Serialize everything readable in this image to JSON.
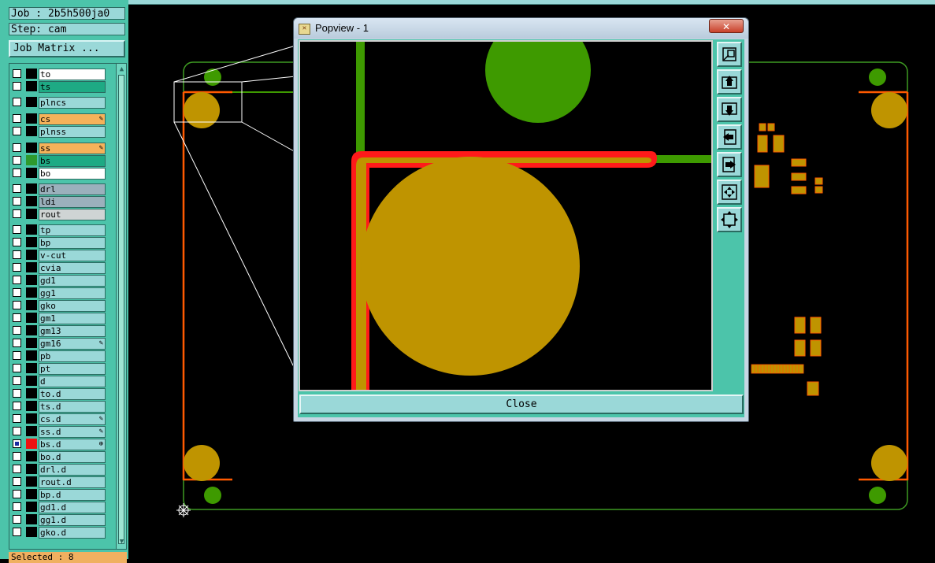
{
  "job_info": {
    "job_label": "Job : 2b5h500ja0",
    "step_label": "Step: cam"
  },
  "job_matrix_button": "Job Matrix ...",
  "layers": [
    {
      "name": "to",
      "bg": "#ffffff",
      "swatch": "#000000"
    },
    {
      "name": "ts",
      "bg": "#1eaa84",
      "swatch": "#000000"
    },
    {
      "name": "plncs",
      "bg": "#9ad8d8",
      "swatch": "#000000"
    },
    {
      "name": "cs",
      "bg": "#f5b25a",
      "swatch": "#000000",
      "mark": "✎"
    },
    {
      "name": "plnss",
      "bg": "#9ad8d8",
      "swatch": "#000000"
    },
    {
      "name": "ss",
      "bg": "#f5b25a",
      "swatch": "#000000",
      "mark": "✎"
    },
    {
      "name": "bs",
      "bg": "#1eaa84",
      "swatch": "#2e9a2e"
    },
    {
      "name": "bo",
      "bg": "#ffffff",
      "swatch": "#000000"
    },
    {
      "name": "drl",
      "bg": "#9bb0bc",
      "swatch": "#000000"
    },
    {
      "name": "ldi",
      "bg": "#9bb0bc",
      "swatch": "#000000"
    },
    {
      "name": "rout",
      "bg": "#cfd4d4",
      "swatch": "#000000"
    },
    {
      "name": "tp",
      "bg": "#9ad8d8",
      "swatch": "#000000"
    },
    {
      "name": "bp",
      "bg": "#9ad8d8",
      "swatch": "#000000"
    },
    {
      "name": "v-cut",
      "bg": "#9ad8d8",
      "swatch": "#000000"
    },
    {
      "name": "cvia",
      "bg": "#9ad8d8",
      "swatch": "#000000"
    },
    {
      "name": "gd1",
      "bg": "#9ad8d8",
      "swatch": "#000000"
    },
    {
      "name": "gg1",
      "bg": "#9ad8d8",
      "swatch": "#000000"
    },
    {
      "name": "gko",
      "bg": "#9ad8d8",
      "swatch": "#000000"
    },
    {
      "name": "gm1",
      "bg": "#9ad8d8",
      "swatch": "#000000"
    },
    {
      "name": "gm13",
      "bg": "#9ad8d8",
      "swatch": "#000000"
    },
    {
      "name": "gm16",
      "bg": "#9ad8d8",
      "swatch": "#000000",
      "mark": "✎"
    },
    {
      "name": "pb",
      "bg": "#9ad8d8",
      "swatch": "#000000"
    },
    {
      "name": "pt",
      "bg": "#9ad8d8",
      "swatch": "#000000"
    },
    {
      "name": "d",
      "bg": "#9ad8d8",
      "swatch": "#000000"
    },
    {
      "name": "to.d",
      "bg": "#9ad8d8",
      "swatch": "#000000"
    },
    {
      "name": "ts.d",
      "bg": "#9ad8d8",
      "swatch": "#000000"
    },
    {
      "name": "cs.d",
      "bg": "#9ad8d8",
      "swatch": "#000000",
      "mark": "✎"
    },
    {
      "name": "ss.d",
      "bg": "#9ad8d8",
      "swatch": "#000000",
      "mark": "✎"
    },
    {
      "name": "bs.d",
      "bg": "#9ad8d8",
      "swatch": "#ee1111",
      "mark": "⊕",
      "checked": true
    },
    {
      "name": "bo.d",
      "bg": "#9ad8d8",
      "swatch": "#000000"
    },
    {
      "name": "drl.d",
      "bg": "#9ad8d8",
      "swatch": "#000000"
    },
    {
      "name": "rout.d",
      "bg": "#9ad8d8",
      "swatch": "#000000"
    },
    {
      "name": "bp.d",
      "bg": "#9ad8d8",
      "swatch": "#000000"
    },
    {
      "name": "gd1.d",
      "bg": "#9ad8d8",
      "swatch": "#000000"
    },
    {
      "name": "gg1.d",
      "bg": "#9ad8d8",
      "swatch": "#000000"
    },
    {
      "name": "gko.d",
      "bg": "#9ad8d8",
      "swatch": "#000000"
    }
  ],
  "status": {
    "selected": "Selected : 8"
  },
  "colors": {
    "panel_teal": "#4cc4aa",
    "layer_bg": "#9ad8d8",
    "board_outline": "#3e9a22",
    "route_orange": "#ff5a00",
    "pad_gold": "#bf9400",
    "pad_green": "#3e9a00",
    "trace_red": "#ff1a1a",
    "canvas_bg": "#000000"
  },
  "popview": {
    "title": "Popview - 1",
    "close_x": "✕",
    "close_button": "Close",
    "tool_icons": [
      "zoom-home-icon",
      "move-up-icon",
      "move-down-icon",
      "move-left-icon",
      "move-right-icon",
      "zoom-in-icon",
      "zoom-out-icon"
    ]
  },
  "canvas": {
    "origin_marker": "origin-marker-icon"
  }
}
